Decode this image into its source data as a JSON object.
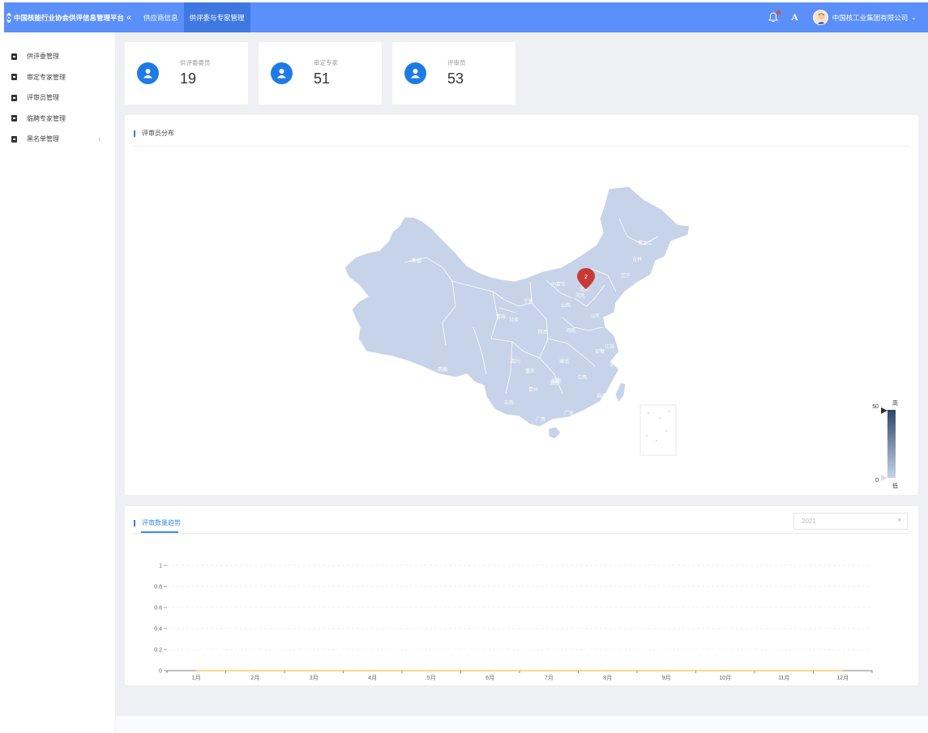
{
  "header": {
    "app_title": "中国核能行业协会供评信息管理平台",
    "collapse_icon": "«",
    "tabs": [
      {
        "label": "供应商信息",
        "active": false
      },
      {
        "label": "供评委与专家管理",
        "active": true
      }
    ],
    "font_toggle": "A",
    "org_name": "中国核工业集团有限公司",
    "dropdown_icon": "chevron-down-icon",
    "color": "#5b8ff9"
  },
  "sidebar": {
    "items": [
      {
        "label": "供评委管理"
      },
      {
        "label": "审定专家管理"
      },
      {
        "label": "评审员管理"
      },
      {
        "label": "临聘专家管理"
      },
      {
        "label": "黑名单管理",
        "caret": "‹"
      }
    ]
  },
  "stats": [
    {
      "label": "供评委委员",
      "value": "19"
    },
    {
      "label": "审定专家",
      "value": "51"
    },
    {
      "label": "评审员",
      "value": "53"
    }
  ],
  "map_panel": {
    "title": "评审员分布",
    "marker_value": "2",
    "legend": {
      "max": "50",
      "min": "0",
      "high_label": "高",
      "low_label": "低",
      "color_high": "#2d4566",
      "color_low": "#c7d3e8"
    },
    "provinces": [
      "新疆",
      "西藏",
      "青海",
      "甘肃",
      "宁夏",
      "内蒙古",
      "山西",
      "陕西",
      "四川",
      "重庆",
      "云南",
      "贵州",
      "广西",
      "广东",
      "湖南",
      "湖北",
      "河南",
      "江西",
      "福建",
      "浙江",
      "安徽",
      "江苏",
      "山东",
      "河北",
      "北京",
      "辽宁",
      "吉林",
      "黑龙江",
      "海南"
    ]
  },
  "trend_panel": {
    "title": "评审数量趋势",
    "year_select": "2021",
    "chart_data": {
      "type": "line",
      "categories": [
        "1月",
        "2月",
        "3月",
        "4月",
        "5月",
        "6月",
        "7月",
        "8月",
        "9月",
        "10月",
        "11月",
        "12月"
      ],
      "y_ticks": [
        "0",
        "0.2",
        "0.4",
        "0.6",
        "0.8",
        "1"
      ],
      "ylim": [
        0,
        1
      ],
      "series": [
        {
          "values": [
            0,
            0,
            0,
            0,
            0,
            0,
            0,
            0,
            0,
            0,
            0,
            0
          ],
          "color": "#f5c242"
        }
      ],
      "grid": true
    }
  }
}
